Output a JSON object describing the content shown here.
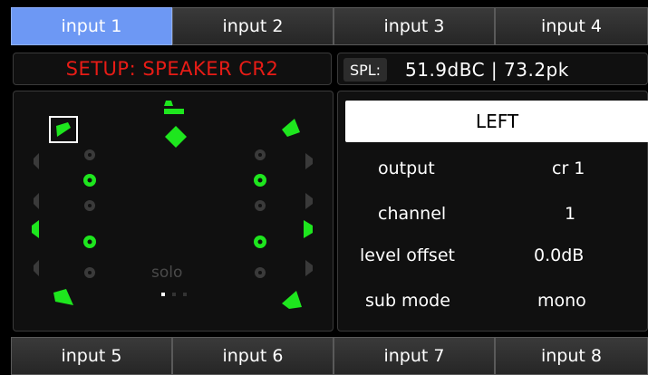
{
  "top_tabs": [
    "input 1",
    "input 2",
    "input 3",
    "input 4"
  ],
  "bottom_tabs": [
    "input 5",
    "input 6",
    "input 7",
    "input 8"
  ],
  "setup": {
    "title": "SETUP: SPEAKER CR2"
  },
  "spl": {
    "label": "SPL:",
    "value": "51.9dBC | 73.2pk"
  },
  "channel_panel": {
    "selected": "LEFT",
    "rows": [
      {
        "label": "output",
        "value": "cr 1"
      },
      {
        "label": "channel",
        "value": "1"
      },
      {
        "label": "level offset",
        "value": "0.0dB"
      },
      {
        "label": "sub mode",
        "value": "mono"
      }
    ]
  },
  "speaker_map": {
    "solo_label": "solo",
    "active_color": "#1ee61e",
    "inactive_color": "#3a3a3a"
  }
}
